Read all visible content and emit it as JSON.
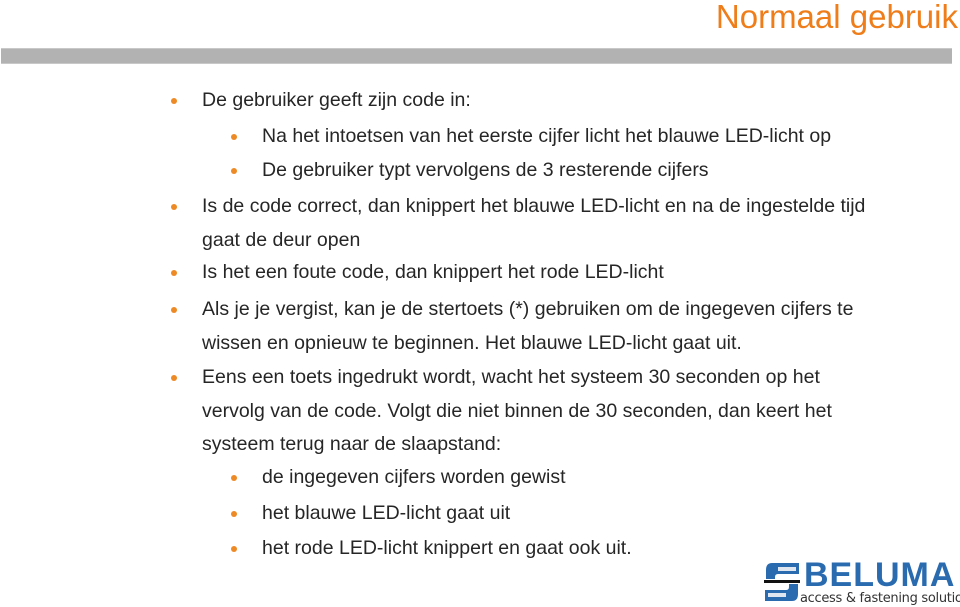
{
  "slide": {
    "title": "Normaal gebruik",
    "accent_color": "#ee7d1a",
    "bullets": [
      {
        "level": 1,
        "lines": [
          "De gebruiker geeft zijn code in:"
        ]
      },
      {
        "level": 2,
        "lines": [
          "Na het intoetsen van het eerste cijfer licht het blauwe LED-licht op"
        ]
      },
      {
        "level": 2,
        "lines": [
          "De gebruiker typt vervolgens de 3 resterende cijfers"
        ]
      },
      {
        "level": 1,
        "lines": [
          "Is de code correct, dan knippert het blauwe LED-licht en na de ingestelde tijd",
          "gaat de deur open"
        ]
      },
      {
        "level": 1,
        "lines": [
          "Is het een foute code, dan knippert het rode LED-licht"
        ]
      },
      {
        "level": 1,
        "lines": [
          "Als je je vergist, kan je de stertoets (*) gebruiken om de ingegeven cijfers te",
          "wissen en opnieuw te beginnen. Het blauwe LED-licht gaat uit."
        ]
      },
      {
        "level": 1,
        "lines": [
          "Eens een toets ingedrukt wordt, wacht het systeem 30 seconden op het",
          "vervolg van de code. Volgt die niet binnen de 30 seconden, dan keert het",
          "systeem terug naar de slaapstand:"
        ]
      },
      {
        "level": 2,
        "lines": [
          "de ingegeven cijfers worden gewist"
        ]
      },
      {
        "level": 2,
        "lines": [
          "het blauwe LED-licht gaat uit"
        ]
      },
      {
        "level": 2,
        "lines": [
          "het rode LED-licht knippert en gaat ook uit."
        ]
      }
    ]
  },
  "logo": {
    "name": "BELUMA",
    "tagline": "access & fastening solutions",
    "color": "#2a6bb0"
  }
}
